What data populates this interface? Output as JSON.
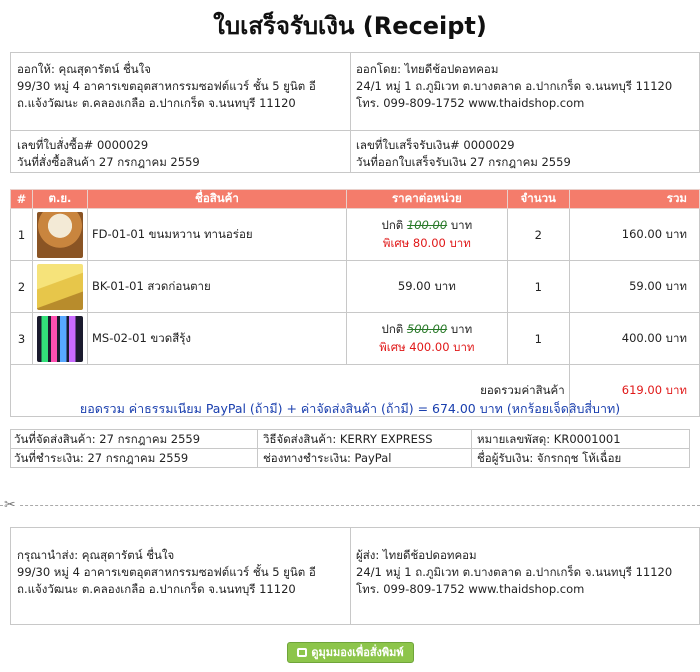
{
  "title": "ใบเสร็จรับเงิน (Receipt)",
  "header": {
    "bill_to": {
      "line1": "ออกให้: คุณสุดารัตน์ ชื่นใจ",
      "line2": "99/30 หมู่ 4 อาคารเขตอุตสาหกรรมซอฟต์แวร์ ชั้น 5 ยูนิต อี",
      "line3": "ถ.แจ้งวัฒนะ ต.คลองเกลือ อ.ปากเกร็ด จ.นนทบุรี 11120"
    },
    "issued_by": {
      "line1": "ออกโดย: ไทยดีช้อปดอทคอม",
      "line2": "24/1 หมู่ 1 ถ.ภูมิเวท ต.บางตลาด อ.ปากเกร็ด จ.นนทบุรี 11120",
      "line3": "โทร. 099-809-1752 www.thaidshop.com"
    },
    "order": {
      "line1": "เลขที่ใบสั่งซื้อ# 0000029",
      "line2": "วันที่สั่งซื้อสินค้า 27 กรกฎาคม 2559"
    },
    "receipt": {
      "line1": "เลขที่ใบเสร็จรับเงิน# 0000029",
      "line2": "วันที่ออกใบเสร็จรับเงิน 27 กรกฎาคม 2559"
    }
  },
  "table": {
    "headers": [
      "#",
      "ต.ย.",
      "ชื่อสินค้า",
      "ราคาต่อหน่วย",
      "จำนวน",
      "รวม"
    ],
    "rows": [
      {
        "num": "1",
        "name": "FD-01-01 ขนมหวาน ทานอร่อย",
        "regular_label": "ปกติ",
        "regular_price": "100.00",
        "unit": "บาท",
        "sale_label": "พิเศษ",
        "sale_price": "80.00 บาท",
        "qty": "2",
        "total": "160.00 บาท",
        "thumb_color": "#c9853e"
      },
      {
        "num": "2",
        "name": "BK-01-01 สวดก่อนตาย",
        "price": "59.00 บาท",
        "qty": "1",
        "total": "59.00 บาท",
        "thumb_color": "#e7c64a"
      },
      {
        "num": "3",
        "name": "MS-02-01 ขวดสีรุ้ง",
        "regular_label": "ปกติ",
        "regular_price": "500.00",
        "unit": "บาท",
        "sale_label": "พิเศษ",
        "sale_price": "400.00 บาท",
        "qty": "1",
        "total": "400.00 บาท",
        "thumb_color": "#1b1b2e"
      }
    ],
    "subtotal_label": "ยอดรวมค่าสินค้า",
    "subtotal_value": "619.00 บาท"
  },
  "grand_total": "ยอดรวม ค่าธรรมเนียม PayPal (ถ้ามี) + ค่าจัดส่งสินค้า (ถ้ามี) = 674.00 บาท (หกร้อยเจ็ดสิบสี่บาท)",
  "shipping": {
    "ship_date": "วันที่จัดส่งสินค้า: 27 กรกฎาคม 2559",
    "ship_method": "วิธีจัดส่งสินค้า: KERRY EXPRESS",
    "tracking": "หมายเลขพัสดุ: KR0001001",
    "pay_date": "วันที่ชำระเงิน: 27 กรกฎาคม 2559",
    "pay_channel": "ช่องทางชำระเงิน: PayPal",
    "payer": "ชื่อผู้รับเงิน: จักรกฤช โห้เฉื่อย"
  },
  "label": {
    "recipient": {
      "line1": "กรุณานำส่ง: คุณสุดารัตน์ ชื่นใจ",
      "line2": "99/30 หมู่ 4 อาคารเขตอุตสาหกรรมซอฟต์แวร์ ชั้น 5 ยูนิต อี",
      "line3": "ถ.แจ้งวัฒนะ ต.คลองเกลือ อ.ปากเกร็ด จ.นนทบุรี 11120"
    },
    "sender": {
      "line1": "ผู้ส่ง: ไทยดีช้อปดอทคอม",
      "line2": "24/1 หมู่ 1 ถ.ภูมิเวท ต.บางตลาด อ.ปากเกร็ด จ.นนทบุรี 11120",
      "line3": "โทร. 099-809-1752 www.thaidshop.com"
    }
  },
  "print_button": "ดูมุมมองเพื่อสั่งพิมพ์",
  "icons": {
    "print": "printer-icon",
    "cut": "scissors-icon"
  },
  "colors": {
    "header_bg": "#f47c6b",
    "button_bg": "#8dc54b",
    "sale": "#e01818",
    "grand": "#1a3fae"
  }
}
